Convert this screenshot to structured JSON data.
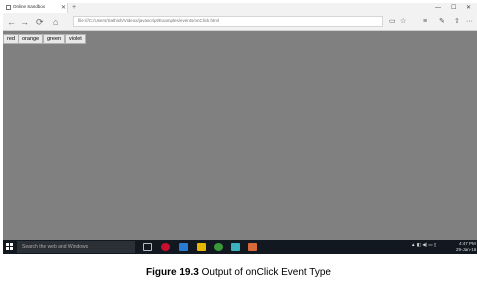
{
  "browser": {
    "tab_title": "Online Sandbox",
    "tab_close": "✕",
    "new_tab": "+",
    "window_controls": [
      "—",
      "☐",
      "✕"
    ],
    "nav": {
      "back": "←",
      "forward": "→",
      "refresh": "⟳",
      "home": "⌂"
    },
    "address": "file:///C:/Users/Sathish/Videos/javascript/Examples/events/onClick.html",
    "toolbar": {
      "reading_view": "▭",
      "favorite": "☆",
      "hub": "≡",
      "note": "✎",
      "share": "⇧",
      "more": "···"
    }
  },
  "page": {
    "buttons": [
      "red",
      "orange",
      "green",
      "violet"
    ]
  },
  "taskbar": {
    "search_placeholder": "Search the web and Windows",
    "tray_time": "4:47 PM",
    "tray_date": "29-Jan-16"
  },
  "caption": {
    "label": "Figure 19.3",
    "text": " Output of onClick Event Type"
  },
  "colors": {
    "page_bg": "#808080",
    "taskbar_bg": "#121820",
    "chrome_bg": "#f2f2f2"
  }
}
